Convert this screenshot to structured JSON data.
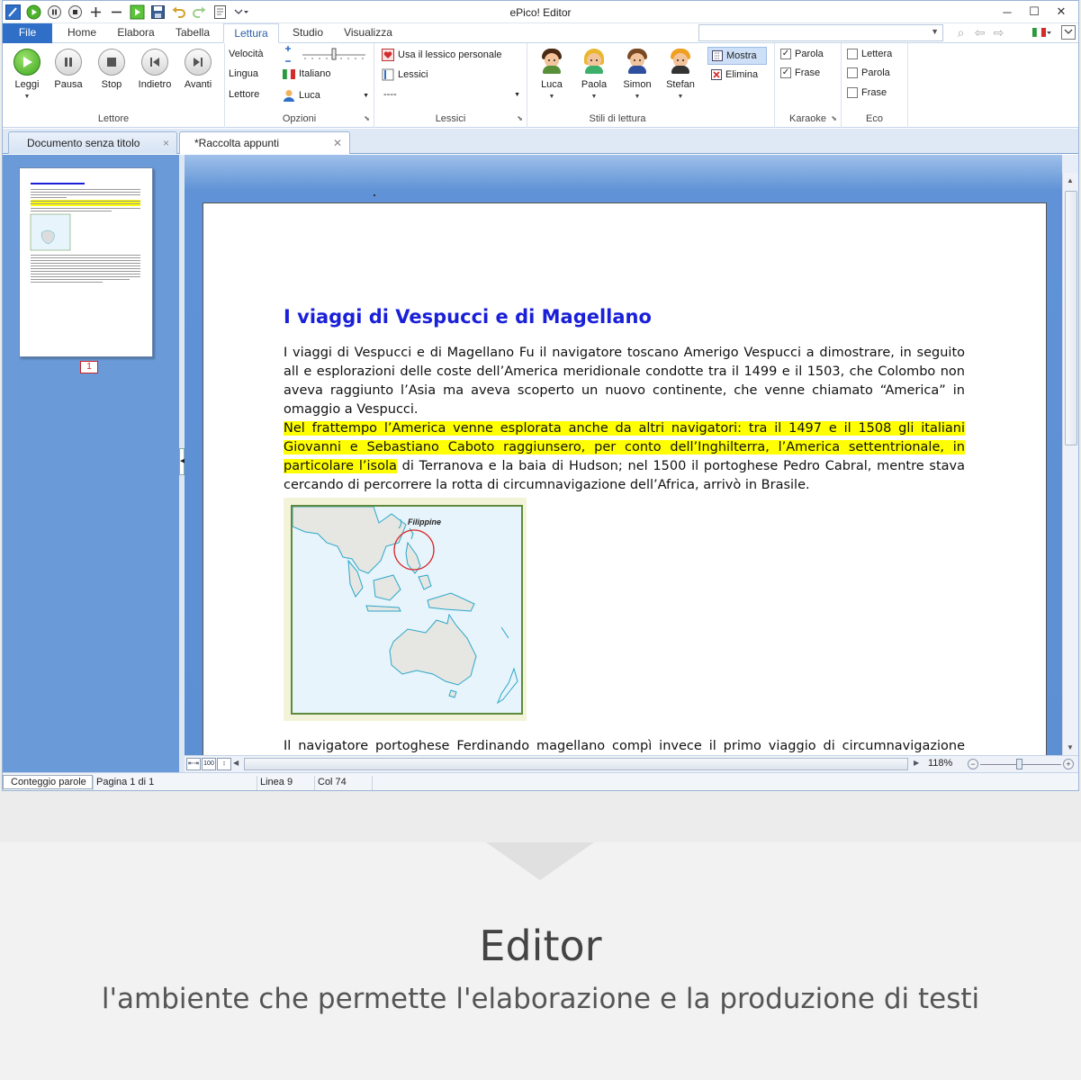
{
  "window": {
    "title": "ePico! Editor"
  },
  "ribbon_tabs": [
    "File",
    "Home",
    "Elabora",
    "Tabella",
    "Lettura",
    "Studio",
    "Visualizza"
  ],
  "active_tab": "Lettura",
  "lettore": {
    "buttons": [
      "Leggi",
      "Pausa",
      "Stop",
      "Indietro",
      "Avanti"
    ],
    "label": "Lettore"
  },
  "opzioni": {
    "velocita_label": "Velocità",
    "lingua_label": "Lingua",
    "lettore_label": "Lettore",
    "lingua_value": "Italiano",
    "lettore_value": "Luca",
    "label": "Opzioni"
  },
  "lessici": {
    "usa_lessico": "Usa il lessico personale",
    "lessici_btn": "Lessici",
    "lessici_value": "----",
    "label": "Lessici"
  },
  "stili": {
    "voices": [
      "Luca",
      "Paola",
      "Simon",
      "Stefan"
    ],
    "label": "Stili di lettura"
  },
  "mostra_elimina": {
    "mostra": "Mostra",
    "elimina": "Elimina"
  },
  "karaoke": {
    "parola": "Parola",
    "frase": "Frase",
    "label": "Karaoke",
    "parola_checked": true,
    "frase_checked": true
  },
  "eco": {
    "lettera": "Lettera",
    "parola": "Parola",
    "frase": "Frase",
    "label": "Eco"
  },
  "doc_tabs": [
    "Documento senza titolo",
    "*Raccolta appunti"
  ],
  "document": {
    "title": "I viaggi di Vespucci e di Magellano",
    "p1": "I viaggi di Vespucci e di Magellano Fu  il  navigatore  toscano  Amerigo Vespucci a dimostrare, in seguito all e esplorazioni delle coste  dell’America meridionale condotte tra il 1499 e  il 1503, che Colombo  non aveva raggiunto l’Asia ma aveva scoperto un nuovo continente,  che venne chiamato “America” in omaggio a Vespucci.",
    "p2_highlight": "Nel frattempo l’America venne esplorata anche da altri navigatori: tra  il 1497 e il 1508 gli italiani Giovanni e Sebastiano Caboto raggiunsero,  per conto dell’Inghilterra, l’America settentrionale, in particolare l’isola",
    "p2_rest": " di Terranova e la baia di Hudson; nel 1500 il portoghese Pedro  Cabral, mentre stava cercando di percorrere la rotta di circumnavigazione  dell’Africa, arrivò in Brasile.",
    "map_label": "Filippine",
    "p3": "Il navigatore portoghese Ferdinando magellano compì invece il primo  viaggio di circumnavigazione della"
  },
  "thumbnail": {
    "page_number": "1"
  },
  "zoom": "118%",
  "status": {
    "word_count": "Conteggio parole",
    "page": "Pagina 1 di 1",
    "line": "Linea 9",
    "col": "Col 74"
  },
  "caption": {
    "title": "Editor",
    "subtitle": "l'ambiente che permette l'elaborazione e la produzione di testi"
  },
  "colors": {
    "accent": "#2f6fc7",
    "doc_title": "#1a20d8",
    "highlight": "#ffff00",
    "workspace": "#5d8fd3"
  }
}
